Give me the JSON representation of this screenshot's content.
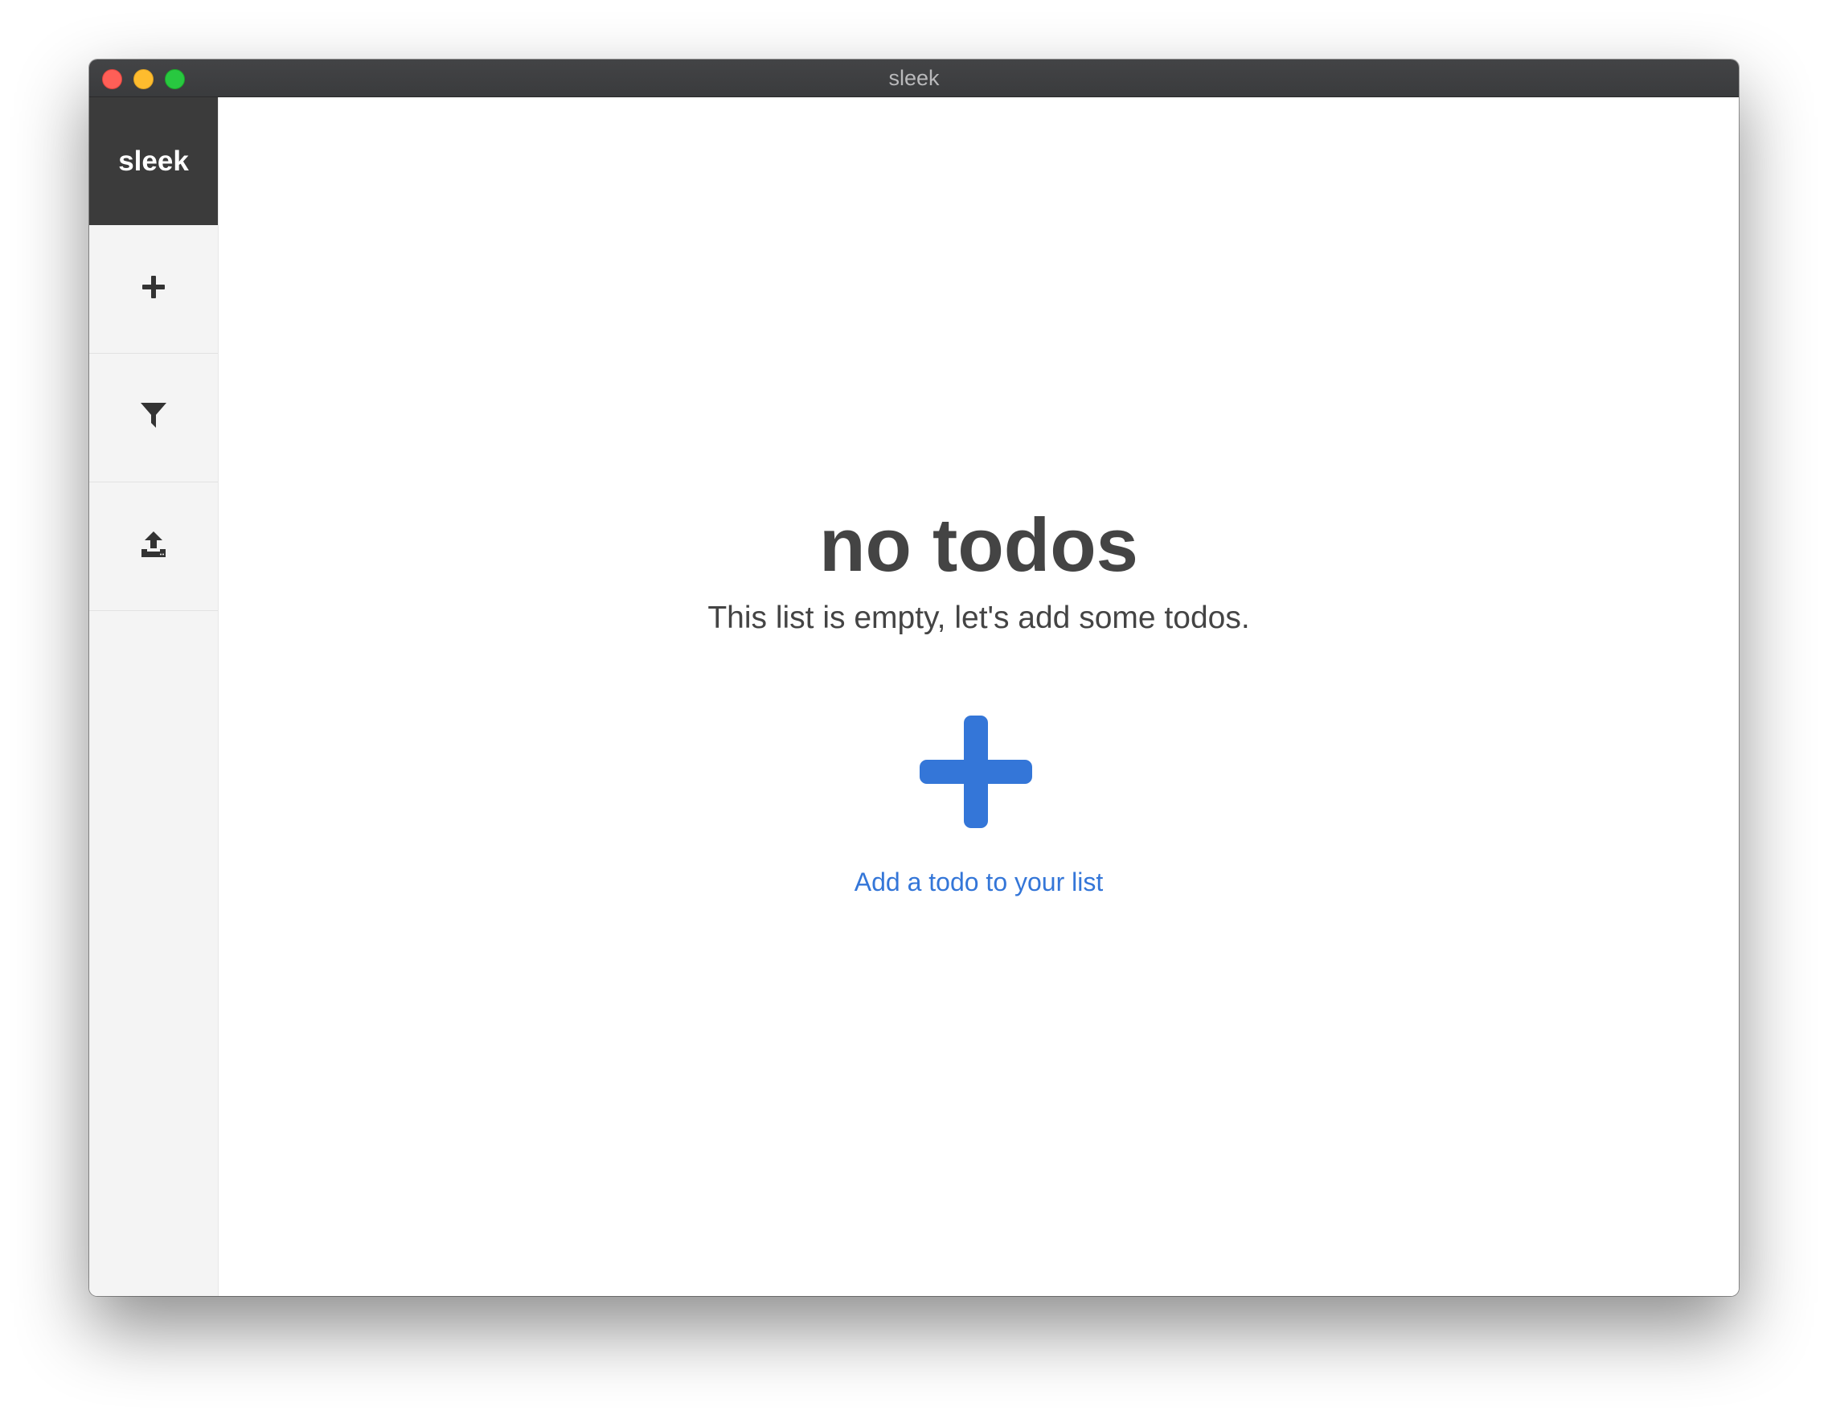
{
  "window": {
    "title": "sleek"
  },
  "sidebar": {
    "brand": "sleek",
    "items": [
      {
        "name": "add",
        "icon": "plus-icon"
      },
      {
        "name": "filter",
        "icon": "filter-icon"
      },
      {
        "name": "open-file",
        "icon": "upload-icon"
      }
    ]
  },
  "main": {
    "empty_title": "no todos",
    "empty_subtitle": "This list is empty, let's add some todos.",
    "add_icon": "plus-icon",
    "add_link": "Add a todo to your list"
  },
  "colors": {
    "accent": "#3476d8",
    "text": "#444444",
    "sidebar_bg": "#f4f4f4",
    "brand_bg": "#3b3b3b",
    "titlebar_bg": "#3a3b3d"
  }
}
